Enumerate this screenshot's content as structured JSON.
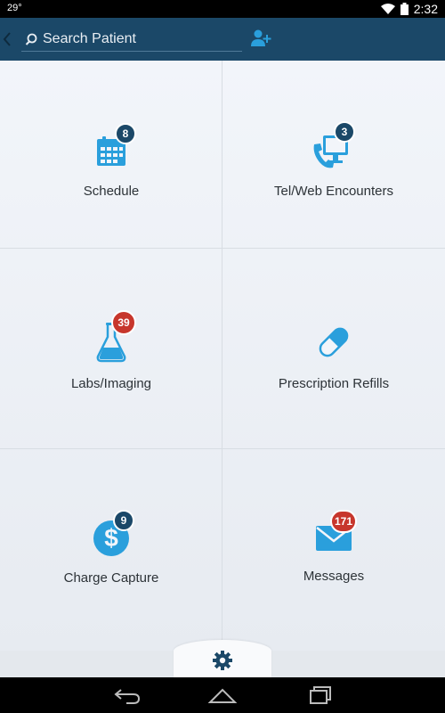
{
  "status_bar": {
    "temperature": "29°",
    "time": "2:32"
  },
  "header": {
    "search_placeholder": "Search Patient",
    "icons": {
      "back": "chevron-left-icon",
      "search": "search-icon",
      "add_user": "add-user-icon"
    }
  },
  "tiles": [
    {
      "label": "Schedule",
      "icon": "calendar-icon",
      "badge": "8",
      "badge_color": "#1b4868"
    },
    {
      "label": "Tel/Web Encounters",
      "icon": "telephone-monitor-icon",
      "badge": "3",
      "badge_color": "#1b4868"
    },
    {
      "label": "Labs/Imaging",
      "icon": "flask-icon",
      "badge": "39",
      "badge_color": "#c7362c"
    },
    {
      "label": "Prescription Refills",
      "icon": "pill-icon",
      "badge": "",
      "badge_color": ""
    },
    {
      "label": "Charge Capture",
      "icon": "dollar-icon",
      "badge": "9",
      "badge_color": "#1b4868"
    },
    {
      "label": "Messages",
      "icon": "envelope-icon",
      "badge": "171",
      "badge_color": "#c7362c"
    }
  ],
  "colors": {
    "accent": "#2a9fdc",
    "header": "#1b4868",
    "badge_blue": "#1b4868",
    "badge_red": "#c7362c"
  }
}
